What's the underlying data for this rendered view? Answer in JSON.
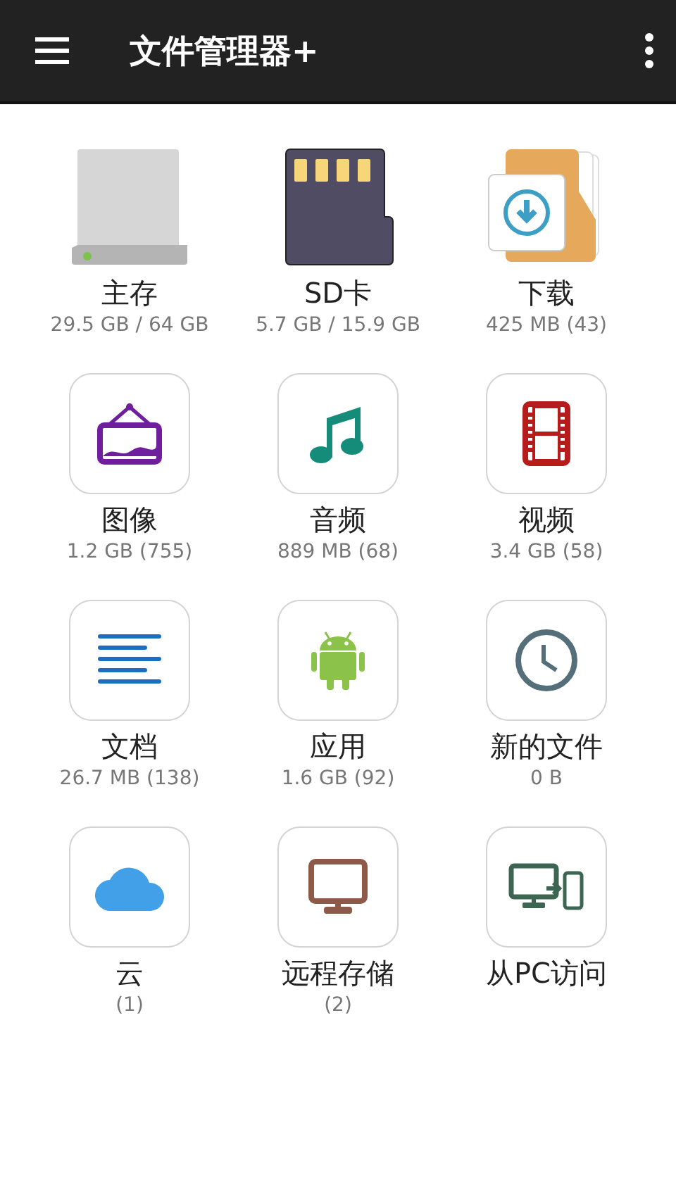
{
  "app_bar": {
    "title": "文件管理器+"
  },
  "items": [
    {
      "kind": "drive",
      "label": "主存",
      "detail": "29.5 GB / 64 GB"
    },
    {
      "kind": "sdcard",
      "label": "SD卡",
      "detail": "5.7 GB / 15.9 GB"
    },
    {
      "kind": "download",
      "label": "下载",
      "detail": "425 MB (43)"
    },
    {
      "kind": "image",
      "label": "图像",
      "detail": "1.2 GB (755)"
    },
    {
      "kind": "music",
      "label": "音频",
      "detail": "889 MB (68)"
    },
    {
      "kind": "video",
      "label": "视频",
      "detail": "3.4 GB (58)"
    },
    {
      "kind": "document",
      "label": "文档",
      "detail": "26.7 MB (138)"
    },
    {
      "kind": "android",
      "label": "应用",
      "detail": "1.6 GB (92)"
    },
    {
      "kind": "clock",
      "label": "新的文件",
      "detail": "0 B"
    },
    {
      "kind": "cloud",
      "label": "云",
      "detail": "(1)"
    },
    {
      "kind": "monitor",
      "label": "远程存储",
      "detail": "(2)"
    },
    {
      "kind": "pc-phone",
      "label": "从PC访问"
    }
  ]
}
